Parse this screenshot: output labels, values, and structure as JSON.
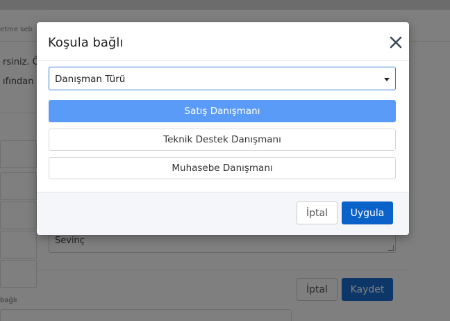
{
  "background": {
    "tab_text": "etme seb",
    "text_line_1": "rsiniz. Ö",
    "text_line_2": "ıfından g",
    "textarea_value": "Sevinç",
    "cancel_label": "İptal",
    "save_label": "Kaydet",
    "small_label": "bağlı"
  },
  "modal": {
    "title": "Koşula bağlı",
    "select": {
      "value": "Danışman Türü"
    },
    "options": [
      {
        "label": "Satış Danışmanı",
        "selected": true
      },
      {
        "label": "Teknik Destek Danışmanı",
        "selected": false
      },
      {
        "label": "Muhasebe Danışmanı",
        "selected": false
      }
    ],
    "cancel_label": "İptal",
    "apply_label": "Uygula"
  },
  "colors": {
    "overlay": "rgba(0,0,0,0.5)",
    "selected_option": "#5b9bf8",
    "primary_button": "#0b62c8",
    "select_border": "#2f7bd6"
  },
  "icons": {
    "close": "close-icon",
    "caret": "caret-down-icon"
  }
}
